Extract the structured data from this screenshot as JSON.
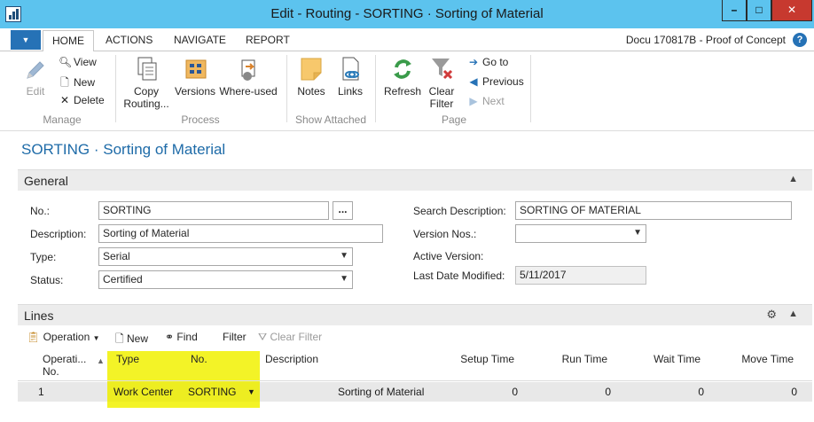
{
  "window": {
    "title": "Edit - Routing - SORTING · Sorting of Material",
    "min_label": "–",
    "max_label": "□",
    "close_label": "✕"
  },
  "tabs": {
    "home": "HOME",
    "actions": "ACTIONS",
    "navigate": "NAVIGATE",
    "report": "REPORT",
    "company": "Docu 170817B - Proof of Concept"
  },
  "ribbon": {
    "manage": {
      "group_label": "Manage",
      "edit": "Edit",
      "view": "View",
      "new": "New",
      "delete": "Delete"
    },
    "process": {
      "group_label": "Process",
      "copy_routing": "Copy Routing...",
      "versions": "Versions",
      "where_used": "Where-used"
    },
    "show_attached": {
      "group_label": "Show Attached",
      "notes": "Notes",
      "links": "Links"
    },
    "page": {
      "group_label": "Page",
      "refresh": "Refresh",
      "clear_filter": "Clear Filter",
      "go_to": "Go to",
      "previous": "Previous",
      "next": "Next"
    }
  },
  "page_title": "SORTING · Sorting of Material",
  "general": {
    "header": "General",
    "no_label": "No.:",
    "no_value": "SORTING",
    "assist_label": "...",
    "description_label": "Description:",
    "description_value": "Sorting of Material",
    "type_label": "Type:",
    "type_value": "Serial",
    "status_label": "Status:",
    "status_value": "Certified",
    "search_description_label": "Search Description:",
    "search_description_value": "SORTING OF MATERIAL",
    "version_nos_label": "Version Nos.:",
    "version_nos_value": "",
    "active_version_label": "Active Version:",
    "last_date_modified_label": "Last Date Modified:",
    "last_date_modified_value": "5/11/2017"
  },
  "lines": {
    "header": "Lines",
    "toolbar": {
      "operation": "Operation",
      "new": "New",
      "find": "Find",
      "filter": "Filter",
      "clear_filter": "Clear Filter"
    },
    "columns": {
      "operation_no": "Operati... No.",
      "type": "Type",
      "no": "No.",
      "description": "Description",
      "setup_time": "Setup Time",
      "run_time": "Run Time",
      "wait_time": "Wait Time",
      "move_time": "Move Time"
    },
    "rows": [
      {
        "operation_no": "1",
        "type": "Work Center",
        "no": "SORTING",
        "description": "Sorting of Material",
        "setup_time": "0",
        "run_time": "0",
        "wait_time": "0",
        "move_time": "0"
      }
    ]
  },
  "colors": {
    "titlebar": "#5cc3ee",
    "accent": "#2672b6",
    "page_title": "#1e6ba8",
    "highlight": "#f3f327",
    "close_button": "#c7392f"
  }
}
